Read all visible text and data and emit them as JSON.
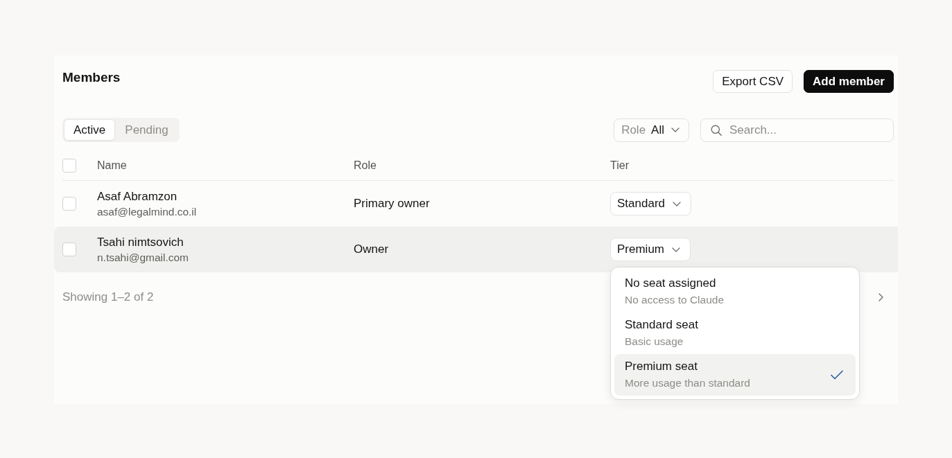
{
  "header": {
    "title": "Members",
    "buttons": [
      {
        "label": "Export CSV",
        "kind": "outline"
      },
      {
        "label": "Add member",
        "kind": "filled"
      }
    ]
  },
  "tabs": [
    {
      "label": "Active",
      "selected": true
    },
    {
      "label": "Pending",
      "selected": false
    }
  ],
  "filters": {
    "role": {
      "label": "Role",
      "value": "All"
    },
    "search": {
      "placeholder": "Search..."
    }
  },
  "table": {
    "select_all_checked": false,
    "columns": [
      "Name",
      "Role",
      "Tier"
    ],
    "rows": [
      {
        "name": "Asaf Abramzon",
        "email": "asaf@legalmind.co.il",
        "role": "Primary owner",
        "tier": "Standard",
        "checked": false,
        "highlighted": false
      },
      {
        "name": "Tsahi nimtsovich",
        "email": "n.tsahi@gmail.com",
        "role": "Owner",
        "tier": "Premium",
        "checked": false,
        "highlighted": true,
        "tier_menu": [
          {
            "title": "No seat assigned",
            "description": "No access to Claude",
            "selected": false
          },
          {
            "title": "Standard seat",
            "description": "Basic usage",
            "selected": false
          },
          {
            "title": "Premium seat",
            "description": "More usage than standard",
            "selected": true
          }
        ]
      }
    ]
  },
  "footer": {
    "summary": "Showing 1–2 of 2"
  }
}
